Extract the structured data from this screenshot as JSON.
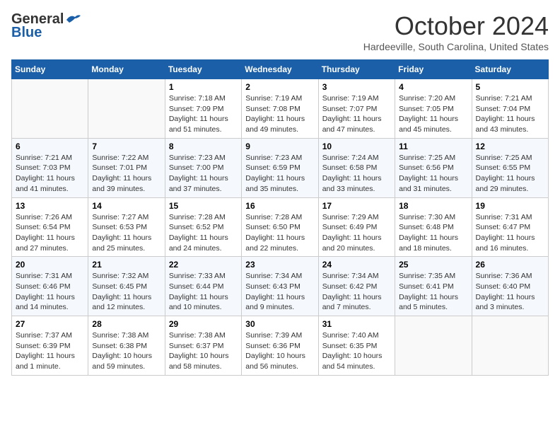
{
  "header": {
    "logo_line1": "General",
    "logo_line2": "Blue",
    "month": "October 2024",
    "location": "Hardeeville, South Carolina, United States"
  },
  "weekdays": [
    "Sunday",
    "Monday",
    "Tuesday",
    "Wednesday",
    "Thursday",
    "Friday",
    "Saturday"
  ],
  "weeks": [
    [
      {
        "day": "",
        "info": ""
      },
      {
        "day": "",
        "info": ""
      },
      {
        "day": "1",
        "info": "Sunrise: 7:18 AM\nSunset: 7:09 PM\nDaylight: 11 hours and 51 minutes."
      },
      {
        "day": "2",
        "info": "Sunrise: 7:19 AM\nSunset: 7:08 PM\nDaylight: 11 hours and 49 minutes."
      },
      {
        "day": "3",
        "info": "Sunrise: 7:19 AM\nSunset: 7:07 PM\nDaylight: 11 hours and 47 minutes."
      },
      {
        "day": "4",
        "info": "Sunrise: 7:20 AM\nSunset: 7:05 PM\nDaylight: 11 hours and 45 minutes."
      },
      {
        "day": "5",
        "info": "Sunrise: 7:21 AM\nSunset: 7:04 PM\nDaylight: 11 hours and 43 minutes."
      }
    ],
    [
      {
        "day": "6",
        "info": "Sunrise: 7:21 AM\nSunset: 7:03 PM\nDaylight: 11 hours and 41 minutes."
      },
      {
        "day": "7",
        "info": "Sunrise: 7:22 AM\nSunset: 7:01 PM\nDaylight: 11 hours and 39 minutes."
      },
      {
        "day": "8",
        "info": "Sunrise: 7:23 AM\nSunset: 7:00 PM\nDaylight: 11 hours and 37 minutes."
      },
      {
        "day": "9",
        "info": "Sunrise: 7:23 AM\nSunset: 6:59 PM\nDaylight: 11 hours and 35 minutes."
      },
      {
        "day": "10",
        "info": "Sunrise: 7:24 AM\nSunset: 6:58 PM\nDaylight: 11 hours and 33 minutes."
      },
      {
        "day": "11",
        "info": "Sunrise: 7:25 AM\nSunset: 6:56 PM\nDaylight: 11 hours and 31 minutes."
      },
      {
        "day": "12",
        "info": "Sunrise: 7:25 AM\nSunset: 6:55 PM\nDaylight: 11 hours and 29 minutes."
      }
    ],
    [
      {
        "day": "13",
        "info": "Sunrise: 7:26 AM\nSunset: 6:54 PM\nDaylight: 11 hours and 27 minutes."
      },
      {
        "day": "14",
        "info": "Sunrise: 7:27 AM\nSunset: 6:53 PM\nDaylight: 11 hours and 25 minutes."
      },
      {
        "day": "15",
        "info": "Sunrise: 7:28 AM\nSunset: 6:52 PM\nDaylight: 11 hours and 24 minutes."
      },
      {
        "day": "16",
        "info": "Sunrise: 7:28 AM\nSunset: 6:50 PM\nDaylight: 11 hours and 22 minutes."
      },
      {
        "day": "17",
        "info": "Sunrise: 7:29 AM\nSunset: 6:49 PM\nDaylight: 11 hours and 20 minutes."
      },
      {
        "day": "18",
        "info": "Sunrise: 7:30 AM\nSunset: 6:48 PM\nDaylight: 11 hours and 18 minutes."
      },
      {
        "day": "19",
        "info": "Sunrise: 7:31 AM\nSunset: 6:47 PM\nDaylight: 11 hours and 16 minutes."
      }
    ],
    [
      {
        "day": "20",
        "info": "Sunrise: 7:31 AM\nSunset: 6:46 PM\nDaylight: 11 hours and 14 minutes."
      },
      {
        "day": "21",
        "info": "Sunrise: 7:32 AM\nSunset: 6:45 PM\nDaylight: 11 hours and 12 minutes."
      },
      {
        "day": "22",
        "info": "Sunrise: 7:33 AM\nSunset: 6:44 PM\nDaylight: 11 hours and 10 minutes."
      },
      {
        "day": "23",
        "info": "Sunrise: 7:34 AM\nSunset: 6:43 PM\nDaylight: 11 hours and 9 minutes."
      },
      {
        "day": "24",
        "info": "Sunrise: 7:34 AM\nSunset: 6:42 PM\nDaylight: 11 hours and 7 minutes."
      },
      {
        "day": "25",
        "info": "Sunrise: 7:35 AM\nSunset: 6:41 PM\nDaylight: 11 hours and 5 minutes."
      },
      {
        "day": "26",
        "info": "Sunrise: 7:36 AM\nSunset: 6:40 PM\nDaylight: 11 hours and 3 minutes."
      }
    ],
    [
      {
        "day": "27",
        "info": "Sunrise: 7:37 AM\nSunset: 6:39 PM\nDaylight: 11 hours and 1 minute."
      },
      {
        "day": "28",
        "info": "Sunrise: 7:38 AM\nSunset: 6:38 PM\nDaylight: 10 hours and 59 minutes."
      },
      {
        "day": "29",
        "info": "Sunrise: 7:38 AM\nSunset: 6:37 PM\nDaylight: 10 hours and 58 minutes."
      },
      {
        "day": "30",
        "info": "Sunrise: 7:39 AM\nSunset: 6:36 PM\nDaylight: 10 hours and 56 minutes."
      },
      {
        "day": "31",
        "info": "Sunrise: 7:40 AM\nSunset: 6:35 PM\nDaylight: 10 hours and 54 minutes."
      },
      {
        "day": "",
        "info": ""
      },
      {
        "day": "",
        "info": ""
      }
    ]
  ]
}
